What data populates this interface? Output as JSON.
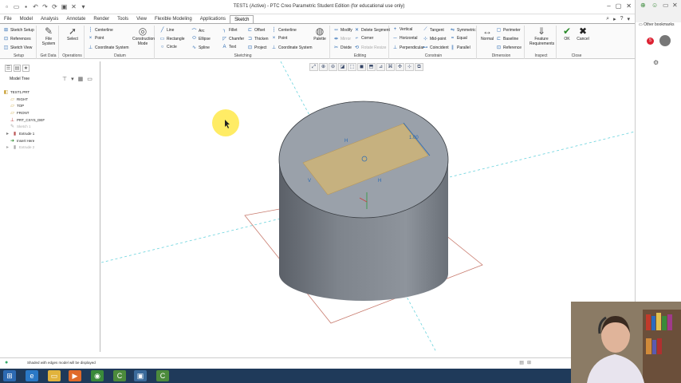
{
  "window": {
    "title": "TEST1 (Active) - PTC Creo Parametric Student Edition (for educational use only)"
  },
  "menu": {
    "tabs": [
      "File",
      "Model",
      "Analysis",
      "Annotate",
      "Render",
      "Tools",
      "View",
      "Flexible Modeling",
      "Applications",
      "Sketch"
    ],
    "active_tab": "Sketch"
  },
  "ribbon": {
    "groups": {
      "setup": "Setup",
      "get_data": "Get Data",
      "operations": "Operations",
      "datum": "Datum",
      "sketching": "Sketching",
      "editing": "Editing",
      "constrain": "Constrain",
      "dimension": "Dimension",
      "inspect": "Inspect",
      "close": "Close"
    },
    "setup_items": [
      "Sketch Setup",
      "References",
      "Sketch View"
    ],
    "file_system": "File System",
    "select": "Select",
    "datum_items": [
      "Centerline",
      "Point",
      "Coordinate System"
    ],
    "construction_mode": "Construction Mode",
    "sketch_col1": [
      "Line",
      "Rectangle",
      "Circle"
    ],
    "sketch_col2": [
      "Arc",
      "Ellipse",
      "Spline"
    ],
    "sketch_col3": [
      "Fillet",
      "Chamfer",
      "Text"
    ],
    "sketch_col4": [
      "Offset",
      "Thicken",
      "Project"
    ],
    "sketch_col5": [
      "Centerline",
      "Point",
      "Coordinate System"
    ],
    "palette": "Palette",
    "editing_col1": [
      "Modify",
      "Mirror",
      "Divide"
    ],
    "editing_col2": [
      "Delete Segment",
      "Corner",
      "Rotate Resize"
    ],
    "constrain_col1": [
      "Vertical",
      "Horizontal",
      "Perpendicular"
    ],
    "constrain_col2": [
      "Tangent",
      "Mid-point",
      "Coincident"
    ],
    "constrain_col3": [
      "Symmetric",
      "Equal",
      "Parallel"
    ],
    "normal": "Normal",
    "dimension_items": [
      "Perimeter",
      "Baseline",
      "Reference"
    ],
    "feature_requirements": "Feature Requirements",
    "ok": "OK",
    "cancel": "Cancel"
  },
  "model_tree": {
    "header": "Model Tree",
    "items": [
      {
        "label": "TEST1.PRT",
        "icon": "part-icon",
        "dim": false
      },
      {
        "label": "RIGHT",
        "icon": "datum-plane-icon",
        "dim": false
      },
      {
        "label": "TOP",
        "icon": "datum-plane-icon",
        "dim": false
      },
      {
        "label": "FRONT",
        "icon": "datum-plane-icon",
        "dim": false
      },
      {
        "label": "PRT_CSYS_DEF",
        "icon": "csys-icon",
        "dim": false
      },
      {
        "label": "Sketch 1",
        "icon": "sketch-icon",
        "dim": true
      },
      {
        "label": "Extrude 1",
        "icon": "extrude-icon",
        "dim": false
      },
      {
        "label": "Insert Here",
        "icon": "insert-arrow-icon",
        "dim": false
      },
      {
        "label": "Extrude 2",
        "icon": "extrude-icon",
        "dim": true
      }
    ]
  },
  "viewport": {
    "dimension_label": "1.00",
    "h_label": "H",
    "v_label": "V"
  },
  "status": {
    "message": "Shaded with edges model will be displayed"
  },
  "browser": {
    "other_bookmarks": "Other bookmarks",
    "badge": "5"
  },
  "colors": {
    "accent": "#2a6ab3",
    "sketch_rect_fill": "#d4b770",
    "cylinder_body": "#80868e",
    "top_face": "#9aa1aa",
    "datum_plane_edge": "#c87b6e",
    "cursor_highlight": "#ffe94a"
  }
}
